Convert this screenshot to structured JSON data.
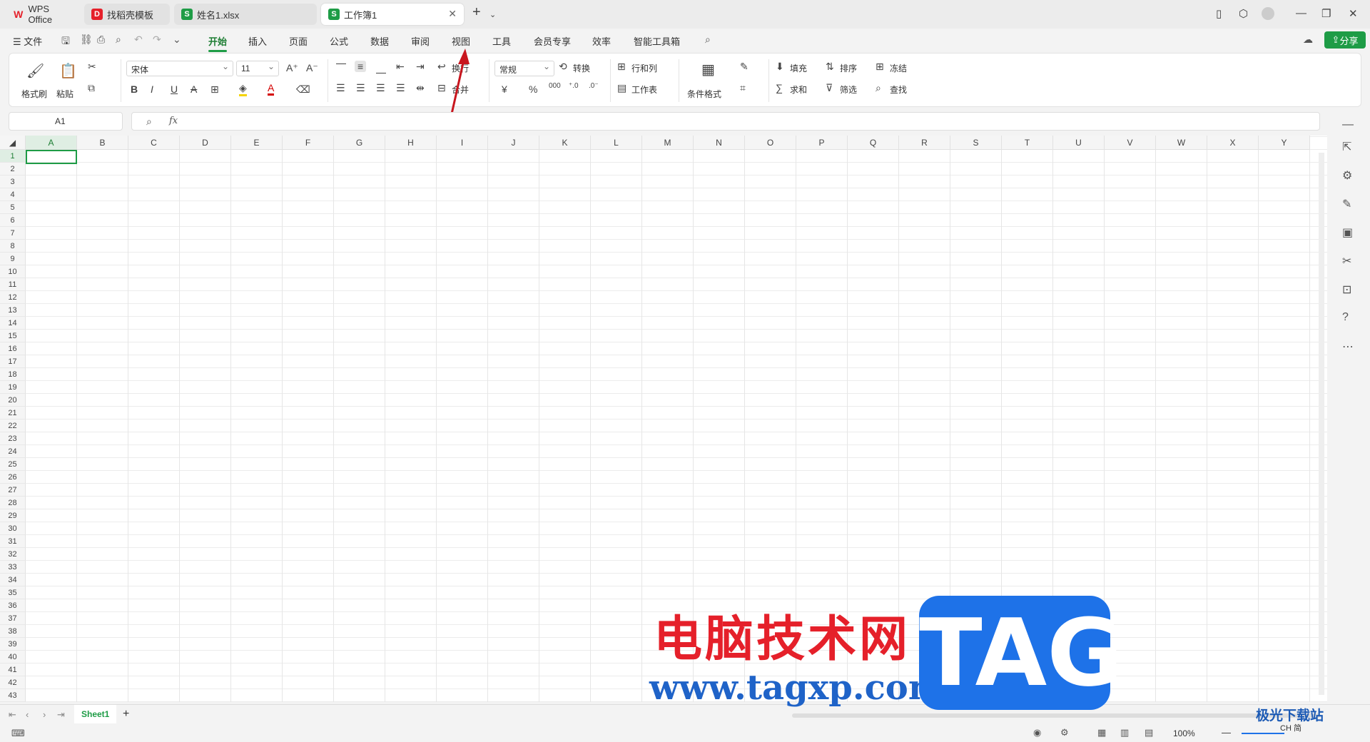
{
  "tabs": [
    {
      "label": "WPS Office"
    },
    {
      "label": "找稻壳模板"
    },
    {
      "label": "姓名1.xlsx"
    },
    {
      "label": "工作簿1"
    }
  ],
  "menu": {
    "file": "文件",
    "items": [
      "开始",
      "插入",
      "页面",
      "公式",
      "数据",
      "审阅",
      "视图",
      "工具",
      "会员专享",
      "效率",
      "智能工具箱"
    ],
    "share": "分享"
  },
  "ribbon": {
    "format_painter": "格式刷",
    "paste": "粘贴",
    "font_name": "宋体",
    "font_size": "11",
    "wrap": "换行",
    "merge": "合并",
    "number_format": "常规",
    "convert": "转换",
    "row_col": "行和列",
    "worksheet": "工作表",
    "cond_format": "条件格式",
    "fill": "填充",
    "sort": "排序",
    "freeze": "冻结",
    "sum": "求和",
    "filter": "筛选",
    "find": "查找"
  },
  "formula": {
    "cell": "A1",
    "fx": "fx"
  },
  "columns": [
    "A",
    "B",
    "C",
    "D",
    "E",
    "F",
    "G",
    "H",
    "I",
    "J",
    "K",
    "L",
    "M",
    "N",
    "O",
    "P",
    "Q",
    "R",
    "S",
    "T",
    "U",
    "V",
    "W",
    "X",
    "Y"
  ],
  "rows": [
    "1",
    "2",
    "3",
    "4",
    "5",
    "6",
    "7",
    "8",
    "9",
    "10",
    "11",
    "12",
    "13",
    "14",
    "15",
    "16",
    "17",
    "18",
    "19",
    "20",
    "21",
    "22",
    "23",
    "24",
    "25",
    "26",
    "27",
    "28",
    "29",
    "30",
    "31",
    "32",
    "33",
    "34",
    "35",
    "36",
    "37",
    "38",
    "39",
    "40",
    "41",
    "42",
    "43"
  ],
  "sheet": {
    "name": "Sheet1",
    "add": "+"
  },
  "status": {
    "zoom": "100%"
  },
  "watermark": {
    "cn": "电脑技术网",
    "url": "www.tagxp.com",
    "tag": "TAG",
    "site2": "极光下载站",
    "ime": "CH 简"
  },
  "colors": {
    "accent": "#1e9c46",
    "arrow": "#c8161e"
  }
}
